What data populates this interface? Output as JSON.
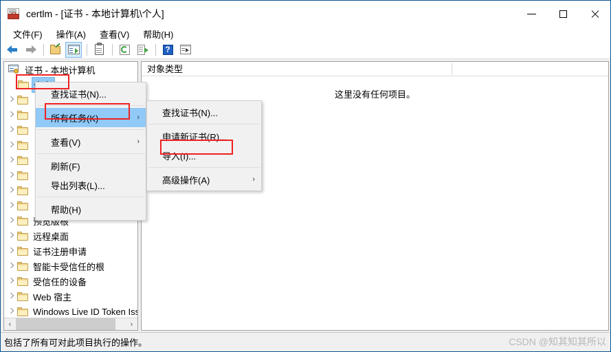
{
  "window": {
    "title": "certlm - [证书 - 本地计算机\\个人]",
    "icon": "certlm-mmc-icon",
    "minimize_label": "最小化",
    "maximize_label": "最大化",
    "close_label": "关闭"
  },
  "menubar": {
    "items": [
      {
        "label": "文件(F)",
        "name": "menu-file"
      },
      {
        "label": "操作(A)",
        "name": "menu-action"
      },
      {
        "label": "查看(V)",
        "name": "menu-view"
      },
      {
        "label": "帮助(H)",
        "name": "menu-help"
      }
    ]
  },
  "toolbar": {
    "buttons": [
      {
        "icon": "back-arrow-icon",
        "label": "后退"
      },
      {
        "icon": "forward-arrow-icon",
        "label": "前进"
      },
      {
        "icon": "open-folder-icon",
        "label": "打开"
      },
      {
        "icon": "show-console-tree-icon",
        "label": "显示/隐藏控制台树",
        "pressed": true
      },
      {
        "icon": "clipboard-icon",
        "label": "属性"
      },
      {
        "icon": "refresh-icon",
        "label": "刷新"
      },
      {
        "icon": "export-list-icon",
        "label": "导出列表"
      },
      {
        "icon": "help-icon",
        "label": "帮助",
        "glyph": "?"
      },
      {
        "icon": "panel-view-icon",
        "label": "显示/隐藏操作窗格"
      }
    ]
  },
  "tree": {
    "root": {
      "label": "证书 - 本地计算机",
      "icon": "console-root-icon"
    },
    "items": [
      {
        "label": "个人",
        "selected": true,
        "hidden_label": false
      },
      {
        "label": "",
        "hidden_label": true
      },
      {
        "label": "",
        "hidden_label": true
      },
      {
        "label": "",
        "hidden_label": true
      },
      {
        "label": "",
        "hidden_label": true
      },
      {
        "label": "",
        "hidden_label": true
      },
      {
        "label": "",
        "hidden_label": true
      },
      {
        "label": "",
        "hidden_label": true
      },
      {
        "label": "",
        "hidden_label": true
      },
      {
        "label": "预览版根",
        "hidden_label": false
      },
      {
        "label": "远程桌面",
        "hidden_label": false
      },
      {
        "label": "证书注册申请",
        "hidden_label": false
      },
      {
        "label": "智能卡受信任的根",
        "hidden_label": false
      },
      {
        "label": "受信任的设备",
        "hidden_label": false
      },
      {
        "label": "Web 宿主",
        "hidden_label": false
      },
      {
        "label": "Windows Live ID Token Iss",
        "hidden_label": false
      }
    ]
  },
  "list": {
    "columns": [
      "对象类型"
    ],
    "empty_message": "这里没有任何项目。"
  },
  "context_menu": {
    "items": [
      {
        "label": "查找证书(N)...",
        "highlighted": false,
        "submenu": false
      },
      {
        "separator": true
      },
      {
        "label": "所有任务(K)",
        "highlighted": true,
        "submenu": true
      },
      {
        "separator": true
      },
      {
        "label": "查看(V)",
        "highlighted": false,
        "submenu": true
      },
      {
        "separator": true
      },
      {
        "label": "刷新(F)",
        "highlighted": false,
        "submenu": false
      },
      {
        "label": "导出列表(L)...",
        "highlighted": false,
        "submenu": false
      },
      {
        "separator": true
      },
      {
        "label": "帮助(H)",
        "highlighted": false,
        "submenu": false
      }
    ]
  },
  "submenu": {
    "items": [
      {
        "label": "查找证书(N)...",
        "submenu": false,
        "boxed": false
      },
      {
        "separator": true
      },
      {
        "label": "申请新证书(R)...",
        "submenu": false,
        "boxed": false
      },
      {
        "label": "导入(I)...",
        "submenu": false,
        "boxed": true
      },
      {
        "separator": true
      },
      {
        "label": "高级操作(A)",
        "submenu": true,
        "boxed": false
      }
    ]
  },
  "statusbar": {
    "text": "包括了所有可对此项目执行的操作。"
  },
  "watermark": {
    "text": "CSDN @知其知其所以"
  },
  "colors": {
    "selection_blue": "#92c9f5",
    "menu_highlight": "#91c9f7",
    "annotation_red": "#f02020",
    "titlebar_border": "#0b5394"
  },
  "scrollbar": {
    "left_arrow": "‹",
    "right_arrow": "›"
  },
  "submenu_arrow": "›"
}
